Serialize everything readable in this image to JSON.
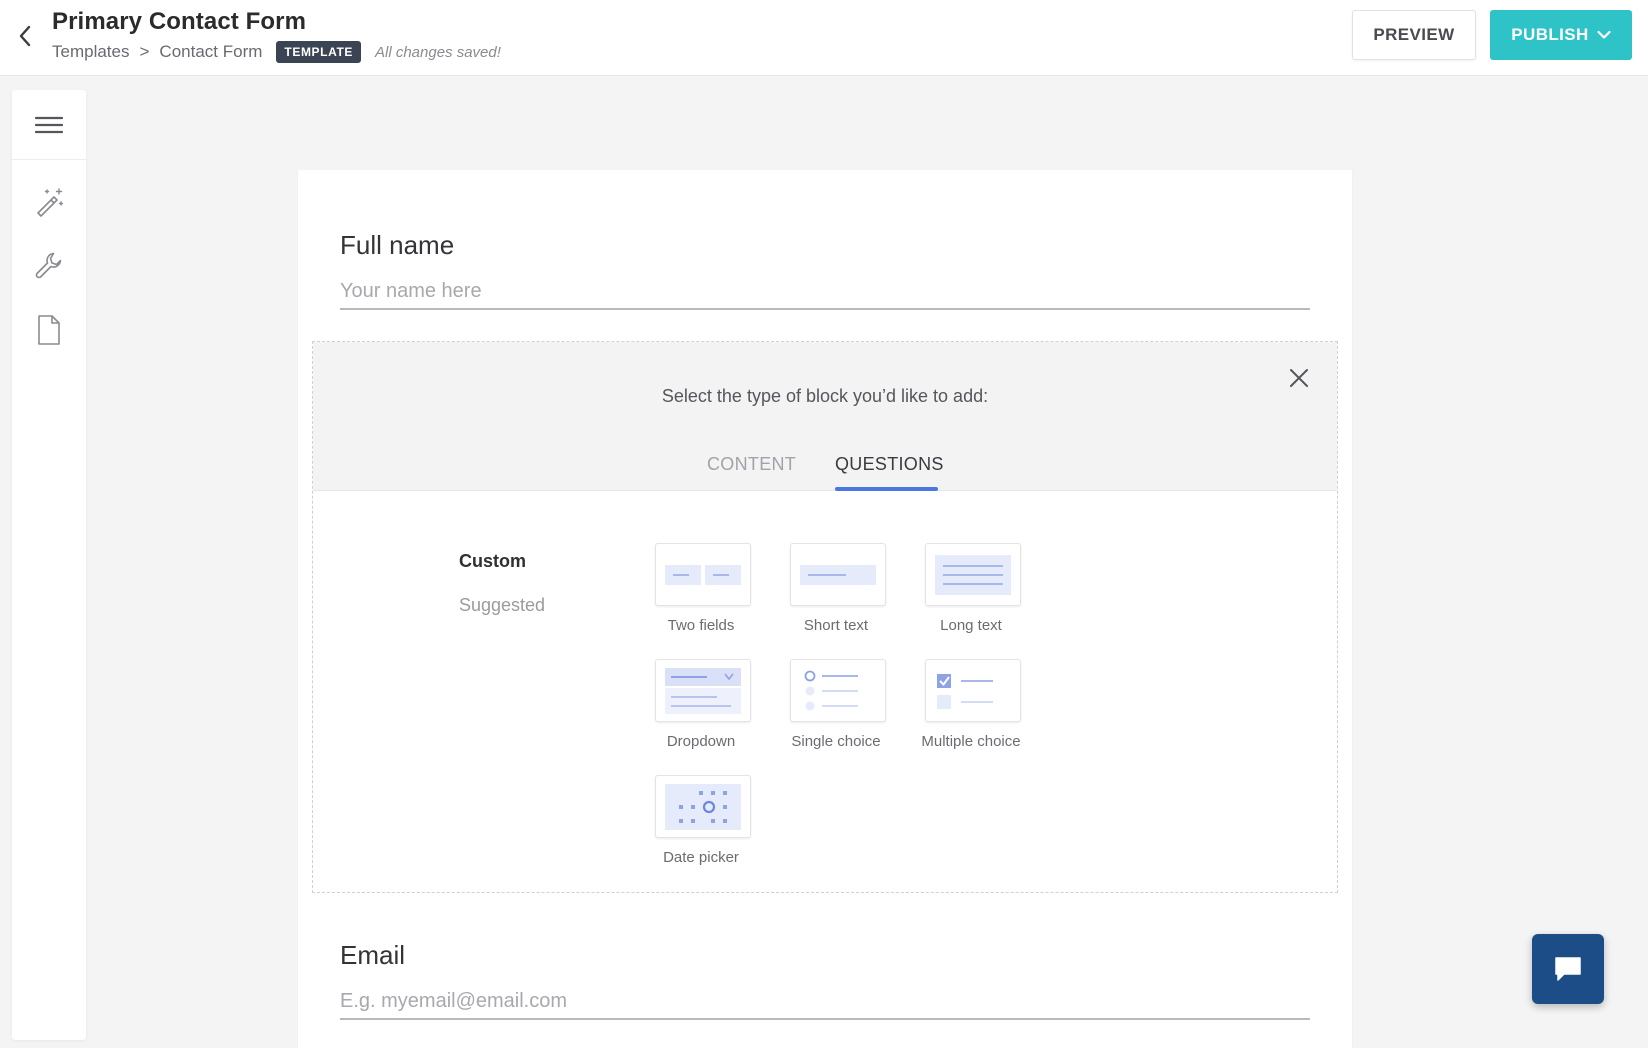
{
  "header": {
    "title": "Primary Contact Form",
    "breadcrumb": [
      "Templates",
      ">",
      "Contact Form"
    ],
    "badge": "TEMPLATE",
    "save_status": "All changes saved!",
    "preview_label": "PREVIEW",
    "publish_label": "PUBLISH"
  },
  "sidebar": {
    "icons": [
      "menu-icon",
      "magic-wand-icon",
      "wrench-icon",
      "document-icon"
    ]
  },
  "form": {
    "fields": [
      {
        "label": "Full name",
        "placeholder": "Your name here"
      },
      {
        "label": "Email",
        "placeholder": "E.g. myemail@email.com"
      }
    ]
  },
  "chooser": {
    "prompt": "Select the type of block you’d like to add:",
    "tabs": [
      {
        "label": "CONTENT",
        "active": false
      },
      {
        "label": "QUESTIONS",
        "active": true
      }
    ],
    "categories": [
      {
        "label": "Custom",
        "active": true
      },
      {
        "label": "Suggested",
        "active": false
      }
    ],
    "blocks": [
      {
        "label": "Two fields",
        "icon": "two-fields-icon"
      },
      {
        "label": "Short text",
        "icon": "short-text-icon"
      },
      {
        "label": "Long text",
        "icon": "long-text-icon"
      },
      {
        "label": "Dropdown",
        "icon": "dropdown-icon"
      },
      {
        "label": "Single choice",
        "icon": "single-choice-icon"
      },
      {
        "label": "Multiple choice",
        "icon": "multiple-choice-icon"
      },
      {
        "label": "Date picker",
        "icon": "date-picker-icon"
      }
    ]
  },
  "colors": {
    "accent": "#2ec3c7",
    "tab_underline": "#4a77e0",
    "chat": "#1d4d86",
    "icon_tint": "#e6ebfb",
    "icon_line": "#a9b8ec"
  }
}
